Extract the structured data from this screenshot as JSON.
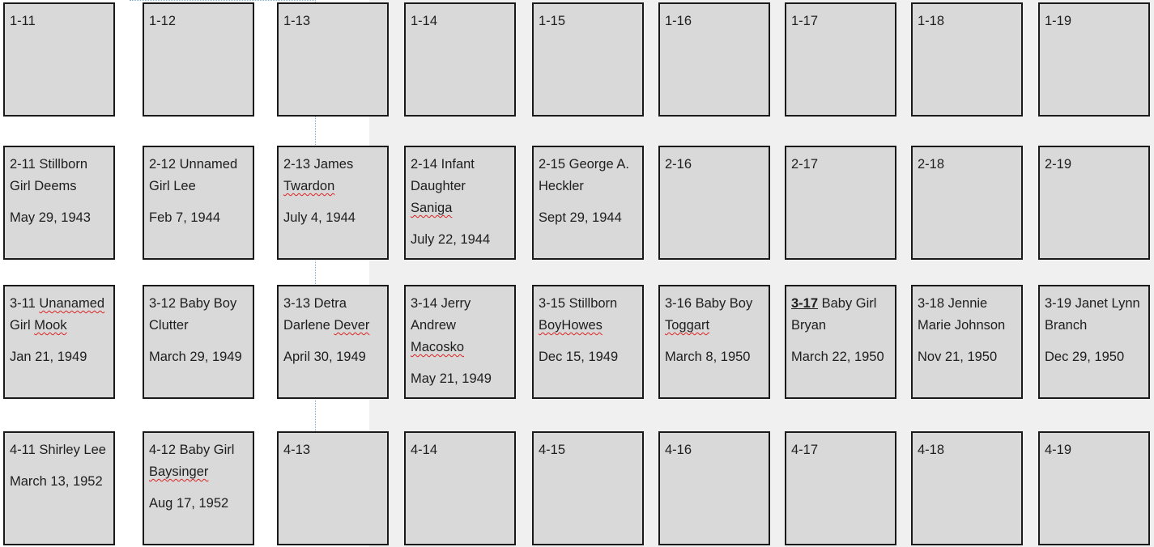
{
  "plots": [
    {
      "row": 1,
      "col": 0,
      "lines": [
        [
          {
            "t": "1-11"
          }
        ]
      ],
      "date": ""
    },
    {
      "row": 1,
      "col": 1,
      "lines": [
        [
          {
            "t": "1-12"
          }
        ]
      ],
      "date": ""
    },
    {
      "row": 1,
      "col": 2,
      "lines": [
        [
          {
            "t": "1-13"
          }
        ]
      ],
      "date": ""
    },
    {
      "row": 1,
      "col": 3,
      "lines": [
        [
          {
            "t": "1-14"
          }
        ]
      ],
      "date": ""
    },
    {
      "row": 1,
      "col": 4,
      "lines": [
        [
          {
            "t": "1-15"
          }
        ]
      ],
      "date": ""
    },
    {
      "row": 1,
      "col": 5,
      "lines": [
        [
          {
            "t": "1-16"
          }
        ]
      ],
      "date": ""
    },
    {
      "row": 1,
      "col": 6,
      "lines": [
        [
          {
            "t": "1-17"
          }
        ]
      ],
      "date": ""
    },
    {
      "row": 1,
      "col": 7,
      "lines": [
        [
          {
            "t": "1-18"
          }
        ]
      ],
      "date": ""
    },
    {
      "row": 1,
      "col": 8,
      "lines": [
        [
          {
            "t": "1-19"
          }
        ]
      ],
      "date": ""
    },
    {
      "row": 2,
      "col": 0,
      "lines": [
        [
          {
            "t": "2-11 Stillborn"
          }
        ],
        [
          {
            "t": "Girl Deems"
          }
        ]
      ],
      "date": "May 29, 1943"
    },
    {
      "row": 2,
      "col": 1,
      "lines": [
        [
          {
            "t": "2-12 Unnamed"
          }
        ],
        [
          {
            "t": "Girl Lee"
          }
        ]
      ],
      "date": "Feb 7, 1944"
    },
    {
      "row": 2,
      "col": 2,
      "lines": [
        [
          {
            "t": "2-13  James"
          }
        ],
        [
          {
            "t": "Twardon",
            "s": "sp"
          }
        ]
      ],
      "date": "July 4, 1944"
    },
    {
      "row": 2,
      "col": 3,
      "lines": [
        [
          {
            "t": "2-14 Infant"
          }
        ],
        [
          {
            "t": "Daughter"
          }
        ],
        [
          {
            "t": "Saniga",
            "s": "sp"
          }
        ]
      ],
      "date": "July 22, 1944"
    },
    {
      "row": 2,
      "col": 4,
      "lines": [
        [
          {
            "t": "2-15 George A."
          }
        ],
        [
          {
            "t": "Heckler"
          }
        ]
      ],
      "date": "Sept 29, 1944"
    },
    {
      "row": 2,
      "col": 5,
      "lines": [
        [
          {
            "t": "2-16"
          }
        ]
      ],
      "date": ""
    },
    {
      "row": 2,
      "col": 6,
      "lines": [
        [
          {
            "t": "2-17"
          }
        ]
      ],
      "date": ""
    },
    {
      "row": 2,
      "col": 7,
      "lines": [
        [
          {
            "t": "2-18"
          }
        ]
      ],
      "date": ""
    },
    {
      "row": 2,
      "col": 8,
      "lines": [
        [
          {
            "t": "2-19"
          }
        ]
      ],
      "date": ""
    },
    {
      "row": 3,
      "col": 0,
      "lines": [
        [
          {
            "t": "3-11 "
          },
          {
            "t": "Unanamed",
            "s": "sp"
          }
        ],
        [
          {
            "t": "Girl "
          },
          {
            "t": "Mook",
            "s": "sp"
          }
        ]
      ],
      "date": "Jan 21, 1949"
    },
    {
      "row": 3,
      "col": 1,
      "lines": [
        [
          {
            "t": "3-12 Baby Boy"
          }
        ],
        [
          {
            "t": "Clutter"
          }
        ]
      ],
      "date": "March 29, 1949"
    },
    {
      "row": 3,
      "col": 2,
      "lines": [
        [
          {
            "t": "3-13 Detra"
          }
        ],
        [
          {
            "t": "Darlene "
          },
          {
            "t": "Dever",
            "s": "sp"
          }
        ]
      ],
      "date": "April 30, 1949"
    },
    {
      "row": 3,
      "col": 3,
      "lines": [
        [
          {
            "t": "3-14  Jerry"
          }
        ],
        [
          {
            "t": "Andrew"
          }
        ],
        [
          {
            "t": "Macosko",
            "s": "sp"
          }
        ]
      ],
      "date": "May 21, 1949"
    },
    {
      "row": 3,
      "col": 4,
      "lines": [
        [
          {
            "t": "3-15 Stillborn"
          }
        ],
        [
          {
            "t": "BoyHowes",
            "s": "sp"
          }
        ]
      ],
      "date": "Dec 15, 1949"
    },
    {
      "row": 3,
      "col": 5,
      "lines": [
        [
          {
            "t": "3-16  Baby Boy"
          }
        ],
        [
          {
            "t": "Toggart",
            "s": "sp"
          }
        ]
      ],
      "date": "March 8, 1950"
    },
    {
      "row": 3,
      "col": 6,
      "lines": [
        [
          {
            "t": "3-17",
            "s": "bu"
          },
          {
            "t": " Baby Girl"
          }
        ],
        [
          {
            "t": "Bryan"
          }
        ]
      ],
      "date": "March 22, 1950"
    },
    {
      "row": 3,
      "col": 7,
      "lines": [
        [
          {
            "t": "3-18 Jennie"
          }
        ],
        [
          {
            "t": "Marie Johnson"
          }
        ]
      ],
      "date": "Nov 21, 1950"
    },
    {
      "row": 3,
      "col": 8,
      "lines": [
        [
          {
            "t": "3-19 Janet Lynn"
          }
        ],
        [
          {
            "t": "Branch"
          }
        ]
      ],
      "date": "Dec 29, 1950"
    },
    {
      "row": 4,
      "col": 0,
      "lines": [
        [
          {
            "t": "4-11 Shirley Lee"
          }
        ]
      ],
      "date": "March 13, 1952"
    },
    {
      "row": 4,
      "col": 1,
      "lines": [
        [
          {
            "t": "4-12  Baby Girl"
          }
        ],
        [
          {
            "t": "Baysinger",
            "s": "sp"
          }
        ]
      ],
      "date": "Aug 17, 1952"
    },
    {
      "row": 4,
      "col": 2,
      "lines": [
        [
          {
            "t": "4-13"
          }
        ]
      ],
      "date": ""
    },
    {
      "row": 4,
      "col": 3,
      "lines": [
        [
          {
            "t": "4-14"
          }
        ]
      ],
      "date": ""
    },
    {
      "row": 4,
      "col": 4,
      "lines": [
        [
          {
            "t": "4-15"
          }
        ]
      ],
      "date": ""
    },
    {
      "row": 4,
      "col": 5,
      "lines": [
        [
          {
            "t": "4-16"
          }
        ]
      ],
      "date": ""
    },
    {
      "row": 4,
      "col": 6,
      "lines": [
        [
          {
            "t": "4-17"
          }
        ]
      ],
      "date": ""
    },
    {
      "row": 4,
      "col": 7,
      "lines": [
        [
          {
            "t": "4-18"
          }
        ]
      ],
      "date": ""
    },
    {
      "row": 4,
      "col": 8,
      "lines": [
        [
          {
            "t": "4-19"
          }
        ]
      ],
      "date": ""
    }
  ]
}
